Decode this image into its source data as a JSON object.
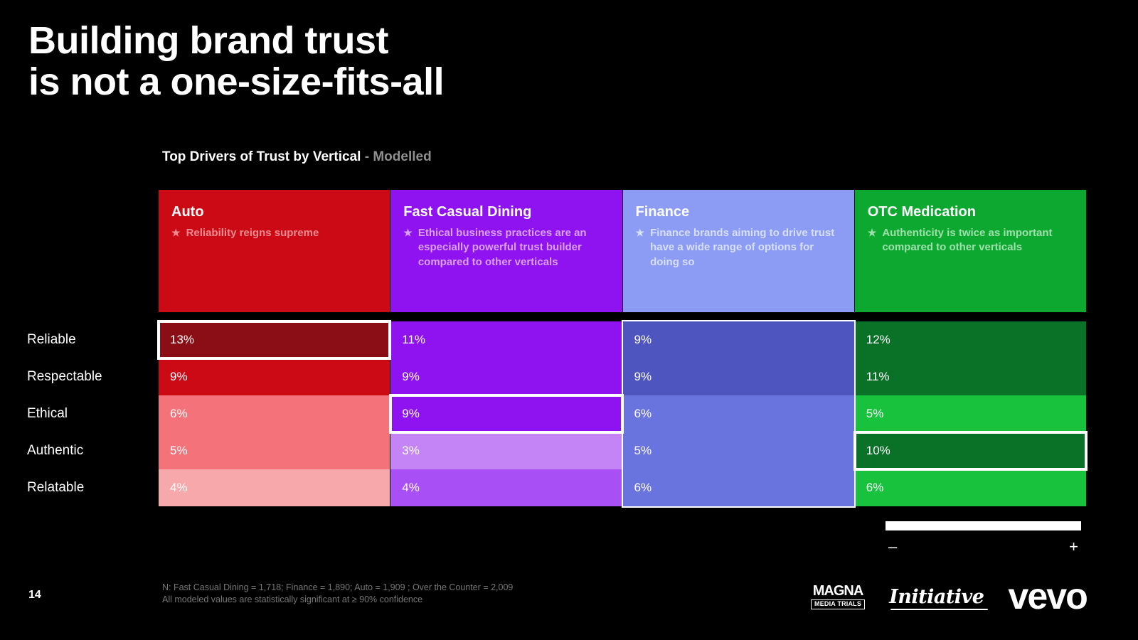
{
  "slide": {
    "title": "Building brand trust\nis not a one-size-fits-all",
    "subtitle_main": "Top Drivers of Trust by Vertical",
    "subtitle_sep": " - ",
    "subtitle_muted": "Modelled",
    "page_number": "14",
    "background_color": "#000000"
  },
  "cards": [
    {
      "name": "auto",
      "title": "Auto",
      "bullet": "Reliability reigns supreme",
      "bg": "#CC0A16",
      "text_tint": "#F08B90",
      "star": "★"
    },
    {
      "name": "fast-casual-dining",
      "title": "Fast Casual Dining",
      "bullet": "Ethical business practices are an especially powerful trust builder compared to other verticals",
      "bg": "#8F12F0",
      "text_tint": "#D9A2F7",
      "star": "★"
    },
    {
      "name": "finance",
      "title": "Finance",
      "bullet": "Finance brands aiming to drive trust have a wide range of options for doing so",
      "bg": "#8C9CF5",
      "text_tint": "#D8DFFB",
      "star": "★"
    },
    {
      "name": "otc-medication",
      "title": "OTC Medication",
      "bullet": "Authenticity is twice as important compared to other verticals",
      "bg": "#0DA82F",
      "text_tint": "#9EE0AC",
      "star": "★"
    }
  ],
  "chart_data": {
    "type": "heatmap",
    "title": "Top Drivers of Trust by Vertical - Modelled",
    "xlabel": "",
    "ylabel": "",
    "categories": [
      "Reliable",
      "Respectable",
      "Ethical",
      "Authentic",
      "Relatable"
    ],
    "columns": [
      "Auto",
      "Fast Casual Dining",
      "Finance",
      "OTC Medication"
    ],
    "series": [
      {
        "name": "Auto",
        "values": [
          13,
          9,
          6,
          5,
          4
        ]
      },
      {
        "name": "Fast Casual Dining",
        "values": [
          11,
          9,
          9,
          3,
          4
        ]
      },
      {
        "name": "Finance",
        "values": [
          9,
          9,
          6,
          5,
          6
        ]
      },
      {
        "name": "OTC Medication",
        "values": [
          12,
          11,
          5,
          10,
          6
        ]
      }
    ],
    "cell_labels": [
      [
        "13%",
        "11%",
        "9%",
        "12%"
      ],
      [
        "9%",
        "9%",
        "9%",
        "11%"
      ],
      [
        "6%",
        "9%",
        "6%",
        "5%"
      ],
      [
        "5%",
        "3%",
        "5%",
        "10%"
      ],
      [
        "4%",
        "4%",
        "6%",
        "6%"
      ]
    ],
    "cell_colors": [
      [
        "#8B0D16",
        "#8F12F0",
        "#4E55BE",
        "#0A7227"
      ],
      [
        "#CC0A16",
        "#8F12F0",
        "#4E55BE",
        "#0A7227"
      ],
      [
        "#F4737A",
        "#8F12F0",
        "#6A74DF",
        "#18C23C"
      ],
      [
        "#F4737A",
        "#C584F5",
        "#6A74DF",
        "#0A7227"
      ],
      [
        "#F7A8AB",
        "#A850F5",
        "#6A74DF",
        "#18C23C"
      ]
    ],
    "highlights": [
      {
        "kind": "cell",
        "row": 0,
        "col": 0,
        "label": "Auto / Reliable = 13%"
      },
      {
        "kind": "cell",
        "row": 2,
        "col": 1,
        "label": "Fast Casual Dining / Ethical = 9%"
      },
      {
        "kind": "column",
        "col": 2,
        "label": "Finance column"
      },
      {
        "kind": "cell",
        "row": 3,
        "col": 3,
        "label": "OTC Medication / Authentic = 10%"
      }
    ],
    "highlight_color": "#FFFFFF",
    "grid": false,
    "legend": "none"
  },
  "slider": {
    "minus_label": "–",
    "plus_label": "+",
    "fill_percent": 100
  },
  "footer": {
    "note_line_1": "N: Fast Casual Dining = 1,718; Finance = 1,890; Auto = 1,909 ; Over the Counter = 2,009",
    "note_line_2": "All modeled values are statistically significant at ≥ 90% confidence"
  },
  "logos": [
    {
      "name": "magna",
      "top": "MAGNA",
      "bottom": "MEDIA TRIALS"
    },
    {
      "name": "initiative",
      "text": "Initiative"
    },
    {
      "name": "vevo",
      "text": "vevo"
    }
  ]
}
